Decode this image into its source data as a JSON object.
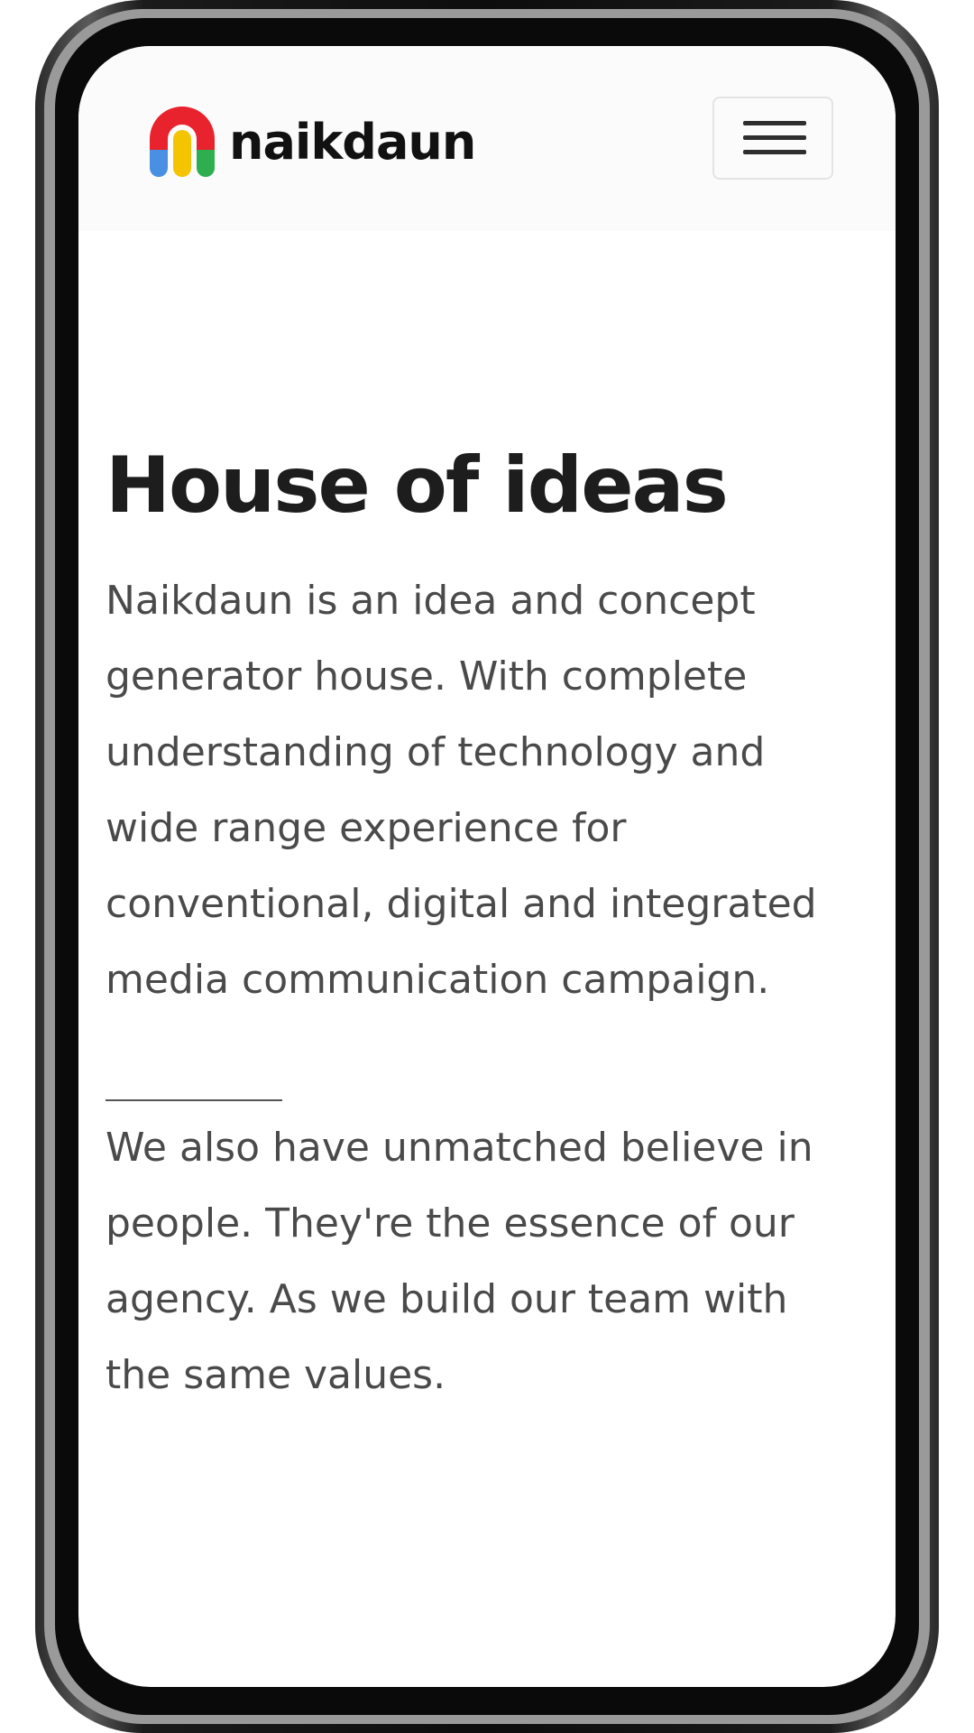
{
  "brand": {
    "name": "naikdaun",
    "logo_icon": "naikdaun-arch-logo-icon",
    "logo_colors": [
      "#e8232d",
      "#f5c400",
      "#4a90e2",
      "#2fae4f"
    ]
  },
  "navbar": {
    "menu_icon": "hamburger-menu-icon"
  },
  "hero": {
    "title": "House of ideas",
    "paragraph_1": "Naikdaun is an idea and concept generator house. With complete understanding of technology and wide range experience for conventional, digital and integrated media communication campaign.",
    "paragraph_2": "We also have unmatched believe in people. They're the essence of our agency. As we build our team with the same values."
  },
  "colors": {
    "title_text": "#1d1d1d",
    "body_text": "#4a4a4a",
    "navbar_bg": "#fbfbfc",
    "phone_bezel": "#0a0a0a"
  }
}
